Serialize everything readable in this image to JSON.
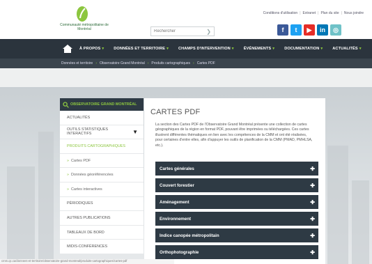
{
  "header": {
    "org_name": "Communauté métropolitaine de Montréal",
    "search_placeholder": "Rechercher",
    "toplinks": [
      "Conditions d'utilisation",
      "Extranet",
      "Plan du site",
      "Nous joindre"
    ],
    "social": [
      {
        "name": "facebook-icon",
        "glyph": "f",
        "color": "#3b5998"
      },
      {
        "name": "twitter-icon",
        "glyph": "t",
        "color": "#1da1f2"
      },
      {
        "name": "youtube-icon",
        "glyph": "▶",
        "color": "#e52d27"
      },
      {
        "name": "linkedin-icon",
        "glyph": "in",
        "color": "#0077b5"
      },
      {
        "name": "instagram-icon",
        "glyph": "◎",
        "color": "#6fc2c8"
      }
    ]
  },
  "nav": {
    "items": [
      "À PROPOS",
      "DONNÉES ET TERRITOIRE",
      "CHAMPS D'INTERVENTION",
      "ÉVÉNEMENTS",
      "DOCUMENTATION",
      "ACTUALITÉS"
    ],
    "accent": "#8cc63f"
  },
  "breadcrumb": [
    "Données et territoire",
    "Observatoire Grand Montréal",
    "Produits cartographiques",
    "Cartes PDF"
  ],
  "sidebar": {
    "title": "OBSERVATOIRE GRAND MONTRÉAL",
    "items": [
      {
        "label": "ACTUALITÉS",
        "style": ""
      },
      {
        "label": "OUTILS STATISTIQUES INTERACTIFS",
        "style": "",
        "caret": "▼"
      },
      {
        "label": "PRODUITS CARTOGRAPHIQUES",
        "style": "green"
      },
      {
        "label": "Cartes PDF",
        "style": "sub green"
      },
      {
        "label": "Données géoréférencées",
        "style": "sub"
      },
      {
        "label": "Cartes interactives",
        "style": "sub"
      },
      {
        "label": "PÉRIODIQUES",
        "style": ""
      },
      {
        "label": "AUTRES PUBLICATIONS",
        "style": ""
      },
      {
        "label": "TABLEAUX DE BORD",
        "style": ""
      },
      {
        "label": "MIDIS-CONFÉRENCES",
        "style": ""
      }
    ]
  },
  "main": {
    "title": "CARTES PDF",
    "intro": "La section des Cartes PDF de l'Observatoire Grand Montréal présente une collection de cartes géographiques de la région en format PDF, pouvant être imprimées ou téléchargées. Ces cartes illustrent différentes thématiques en lien avec les compétences de la CMM et ont été réalisées, pour certaines d'entre elles, afin d'appuyer les outils de planification de la CMM (PMAD, PMHLSA, etc.).",
    "accordion": [
      "Cartes générales",
      "Couvert forestier",
      "Aménagement",
      "Environnement",
      "Indice canopée métropolitain",
      "Orthophotographie"
    ]
  },
  "status": "cmm.qc.ca/donnees-et-territoire/observatoire-grand-montreal/produits-cartographiques/cartes-pdf"
}
